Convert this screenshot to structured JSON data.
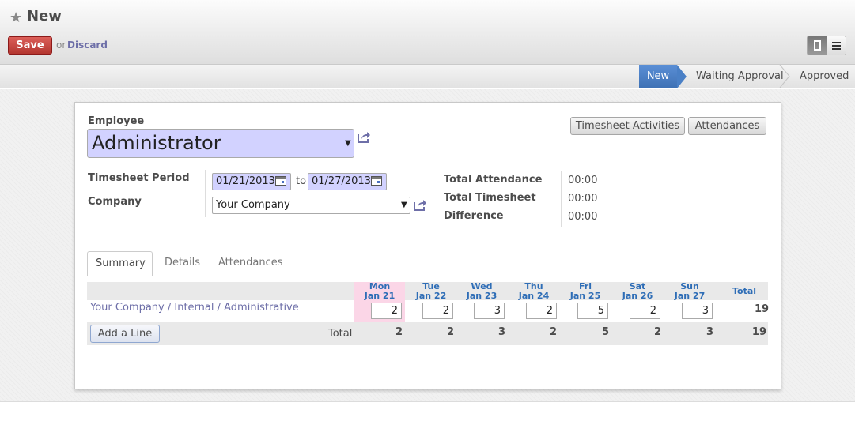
{
  "header": {
    "title": "New",
    "save_label": "Save",
    "or_text": "or",
    "discard_label": "Discard"
  },
  "statusbar": {
    "stages": [
      "New",
      "Waiting Approval",
      "Approved"
    ],
    "current": "New",
    "accent_color": "#4a80c6"
  },
  "form": {
    "employee_label": "Employee",
    "employee_value": "Administrator",
    "period_label": "Timesheet Period",
    "date_from": "01/21/2013",
    "to_text": "to",
    "date_to": "01/27/2013",
    "company_label": "Company",
    "company_value": "Your Company",
    "buttons": {
      "timesheet_activities": "Timesheet Activities",
      "attendances": "Attendances"
    },
    "summary_fields": [
      {
        "label": "Total Attendance",
        "value": "00:00"
      },
      {
        "label": "Total Timesheet",
        "value": "00:00"
      },
      {
        "label": "Difference",
        "value": "00:00"
      }
    ]
  },
  "tabs": [
    "Summary",
    "Details",
    "Attendances"
  ],
  "grid": {
    "days": [
      {
        "dow": "Mon",
        "date": "Jan 21"
      },
      {
        "dow": "Tue",
        "date": "Jan 22"
      },
      {
        "dow": "Wed",
        "date": "Jan 23"
      },
      {
        "dow": "Thu",
        "date": "Jan 24"
      },
      {
        "dow": "Fri",
        "date": "Jan 25"
      },
      {
        "dow": "Sat",
        "date": "Jan 26"
      },
      {
        "dow": "Sun",
        "date": "Jan 27"
      }
    ],
    "total_header": "Total",
    "row": {
      "account": "Your Company / Internal / Administrative",
      "values": [
        "2",
        "2",
        "3",
        "2",
        "5",
        "2",
        "3"
      ],
      "total": "19"
    },
    "add_line_label": "Add a Line",
    "total_label": "Total",
    "column_totals": [
      "2",
      "2",
      "3",
      "2",
      "5",
      "2",
      "3"
    ],
    "grand_total": "19"
  },
  "icons": {
    "star": "star-icon",
    "external": "external-link-icon",
    "calendar": "calendar-icon"
  }
}
